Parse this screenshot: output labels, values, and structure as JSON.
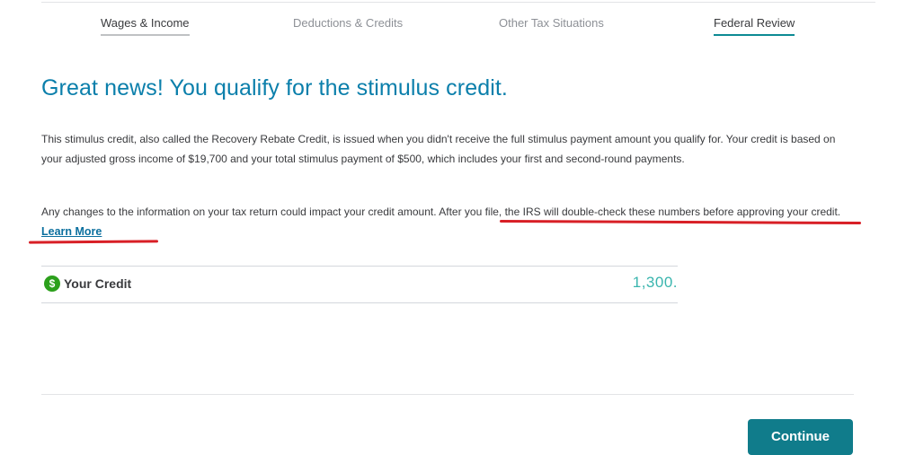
{
  "nav": {
    "tabs": [
      {
        "label": "Wages & Income",
        "state": "complete"
      },
      {
        "label": "Deductions & Credits",
        "state": "upcoming"
      },
      {
        "label": "Other Tax Situations",
        "state": "upcoming"
      },
      {
        "label": "Federal Review",
        "state": "active"
      }
    ]
  },
  "main": {
    "headline": "Great news! You qualify for the stimulus credit.",
    "paragraph1": "This stimulus credit, also called the Recovery Rebate Credit, is issued when you didn't receive the full stimulus payment amount you qualify for. Your credit is based on your adjusted gross income of $19,700 and your total stimulus payment of $500, which includes your first and second-round payments.",
    "paragraph2": "Any changes to the information on your tax return could impact your credit amount. After you file, the IRS will double-check these numbers before approving your credit.",
    "learn_more": "Learn More",
    "credit": {
      "icon_glyph": "$",
      "icon": "dollar-circle-icon",
      "label": "Your Credit",
      "value": "1,300."
    },
    "continue_label": "Continue"
  },
  "colors": {
    "headline": "#0b7fab",
    "active_tab": "#0d8a94",
    "credit_value": "#3ab5ae",
    "dollar_icon": "#2ca01c",
    "button": "#107c8b",
    "annotation": "#d81f26"
  }
}
